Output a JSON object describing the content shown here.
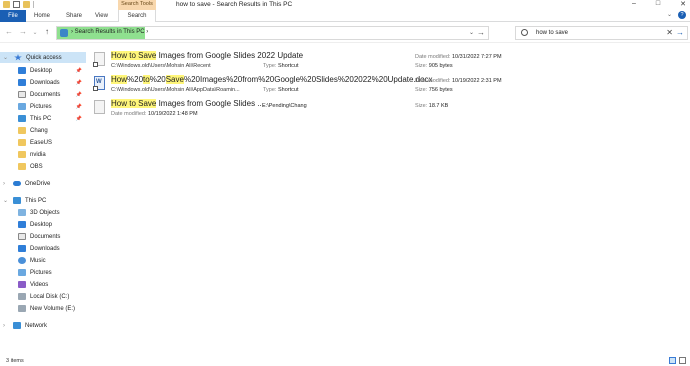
{
  "window": {
    "title": "how to save - Search Results in This PC",
    "controls": [
      "–",
      "□",
      "✕"
    ]
  },
  "ribbon": {
    "contextual_group": "Search Tools",
    "tabs": [
      "File",
      "Home",
      "Share",
      "View",
      "Search"
    ],
    "collapse_glyph": "⌄",
    "help_glyph": "?"
  },
  "nav": {
    "back": "←",
    "forward": "→",
    "recent": "⌄",
    "up": "↑"
  },
  "address": {
    "path": "› Search Results in This PC ›",
    "dropdown": "⌄",
    "refresh": "→"
  },
  "search": {
    "value": "how to save",
    "clear": "✕",
    "go": "→"
  },
  "sidebar": {
    "quick_access": {
      "label": "Quick access",
      "items": [
        {
          "label": "Desktop",
          "pinned": true
        },
        {
          "label": "Downloads",
          "pinned": true
        },
        {
          "label": "Documents",
          "pinned": true
        },
        {
          "label": "Pictures",
          "pinned": true
        },
        {
          "label": "This PC",
          "pinned": true
        },
        {
          "label": "Chang",
          "pinned": false
        },
        {
          "label": "EaseUS",
          "pinned": false
        },
        {
          "label": "nvidia",
          "pinned": false
        },
        {
          "label": "OBS",
          "pinned": false
        }
      ]
    },
    "onedrive": "OneDrive",
    "this_pc": {
      "label": "This PC",
      "items": [
        "3D Objects",
        "Desktop",
        "Documents",
        "Downloads",
        "Music",
        "Pictures",
        "Videos",
        "Local Disk (C:)",
        "New Volume (E:)"
      ]
    },
    "network": "Network"
  },
  "results": [
    {
      "name_parts": [
        {
          "text": "How to Save",
          "hl": true
        },
        {
          "text": " Images from Google Slides 2022 Update",
          "hl": false
        }
      ],
      "path": "C:\\Windows.old\\Users\\Mohsin Ali\\Recent",
      "type_label": "Type:",
      "type": "Shortcut",
      "date_label": "Date modified:",
      "date": "10/31/2022 7:27 PM",
      "size_label": "Size:",
      "size": "905 bytes"
    },
    {
      "name_parts": [
        {
          "text": "How",
          "hl": true
        },
        {
          "text": "%20",
          "hl": false
        },
        {
          "text": "to",
          "hl": true
        },
        {
          "text": "%20",
          "hl": false
        },
        {
          "text": "Save",
          "hl": true
        },
        {
          "text": "%20Images%20from%20Google%20Slides%202022%20Update.docx",
          "hl": false
        }
      ],
      "path": "C:\\Windows.old\\Users\\Mohsin Ali\\AppData\\Roamin...",
      "type_label": "Type:",
      "type": "Shortcut",
      "date_label": "Date modified:",
      "date": "10/19/2022 2:31 PM",
      "size_label": "Size:",
      "size": "756 bytes"
    },
    {
      "name_parts": [
        {
          "text": "How to Save",
          "hl": true
        },
        {
          "text": " Images from Google Slides ...",
          "hl": false
        }
      ],
      "location": "E:\\Pending\\Chang",
      "date_label": "Date modified:",
      "date": "10/19/2022 1:48 PM",
      "size_label": "Size:",
      "size": "18.7 KB"
    }
  ],
  "status": {
    "item_count": "3 items"
  }
}
